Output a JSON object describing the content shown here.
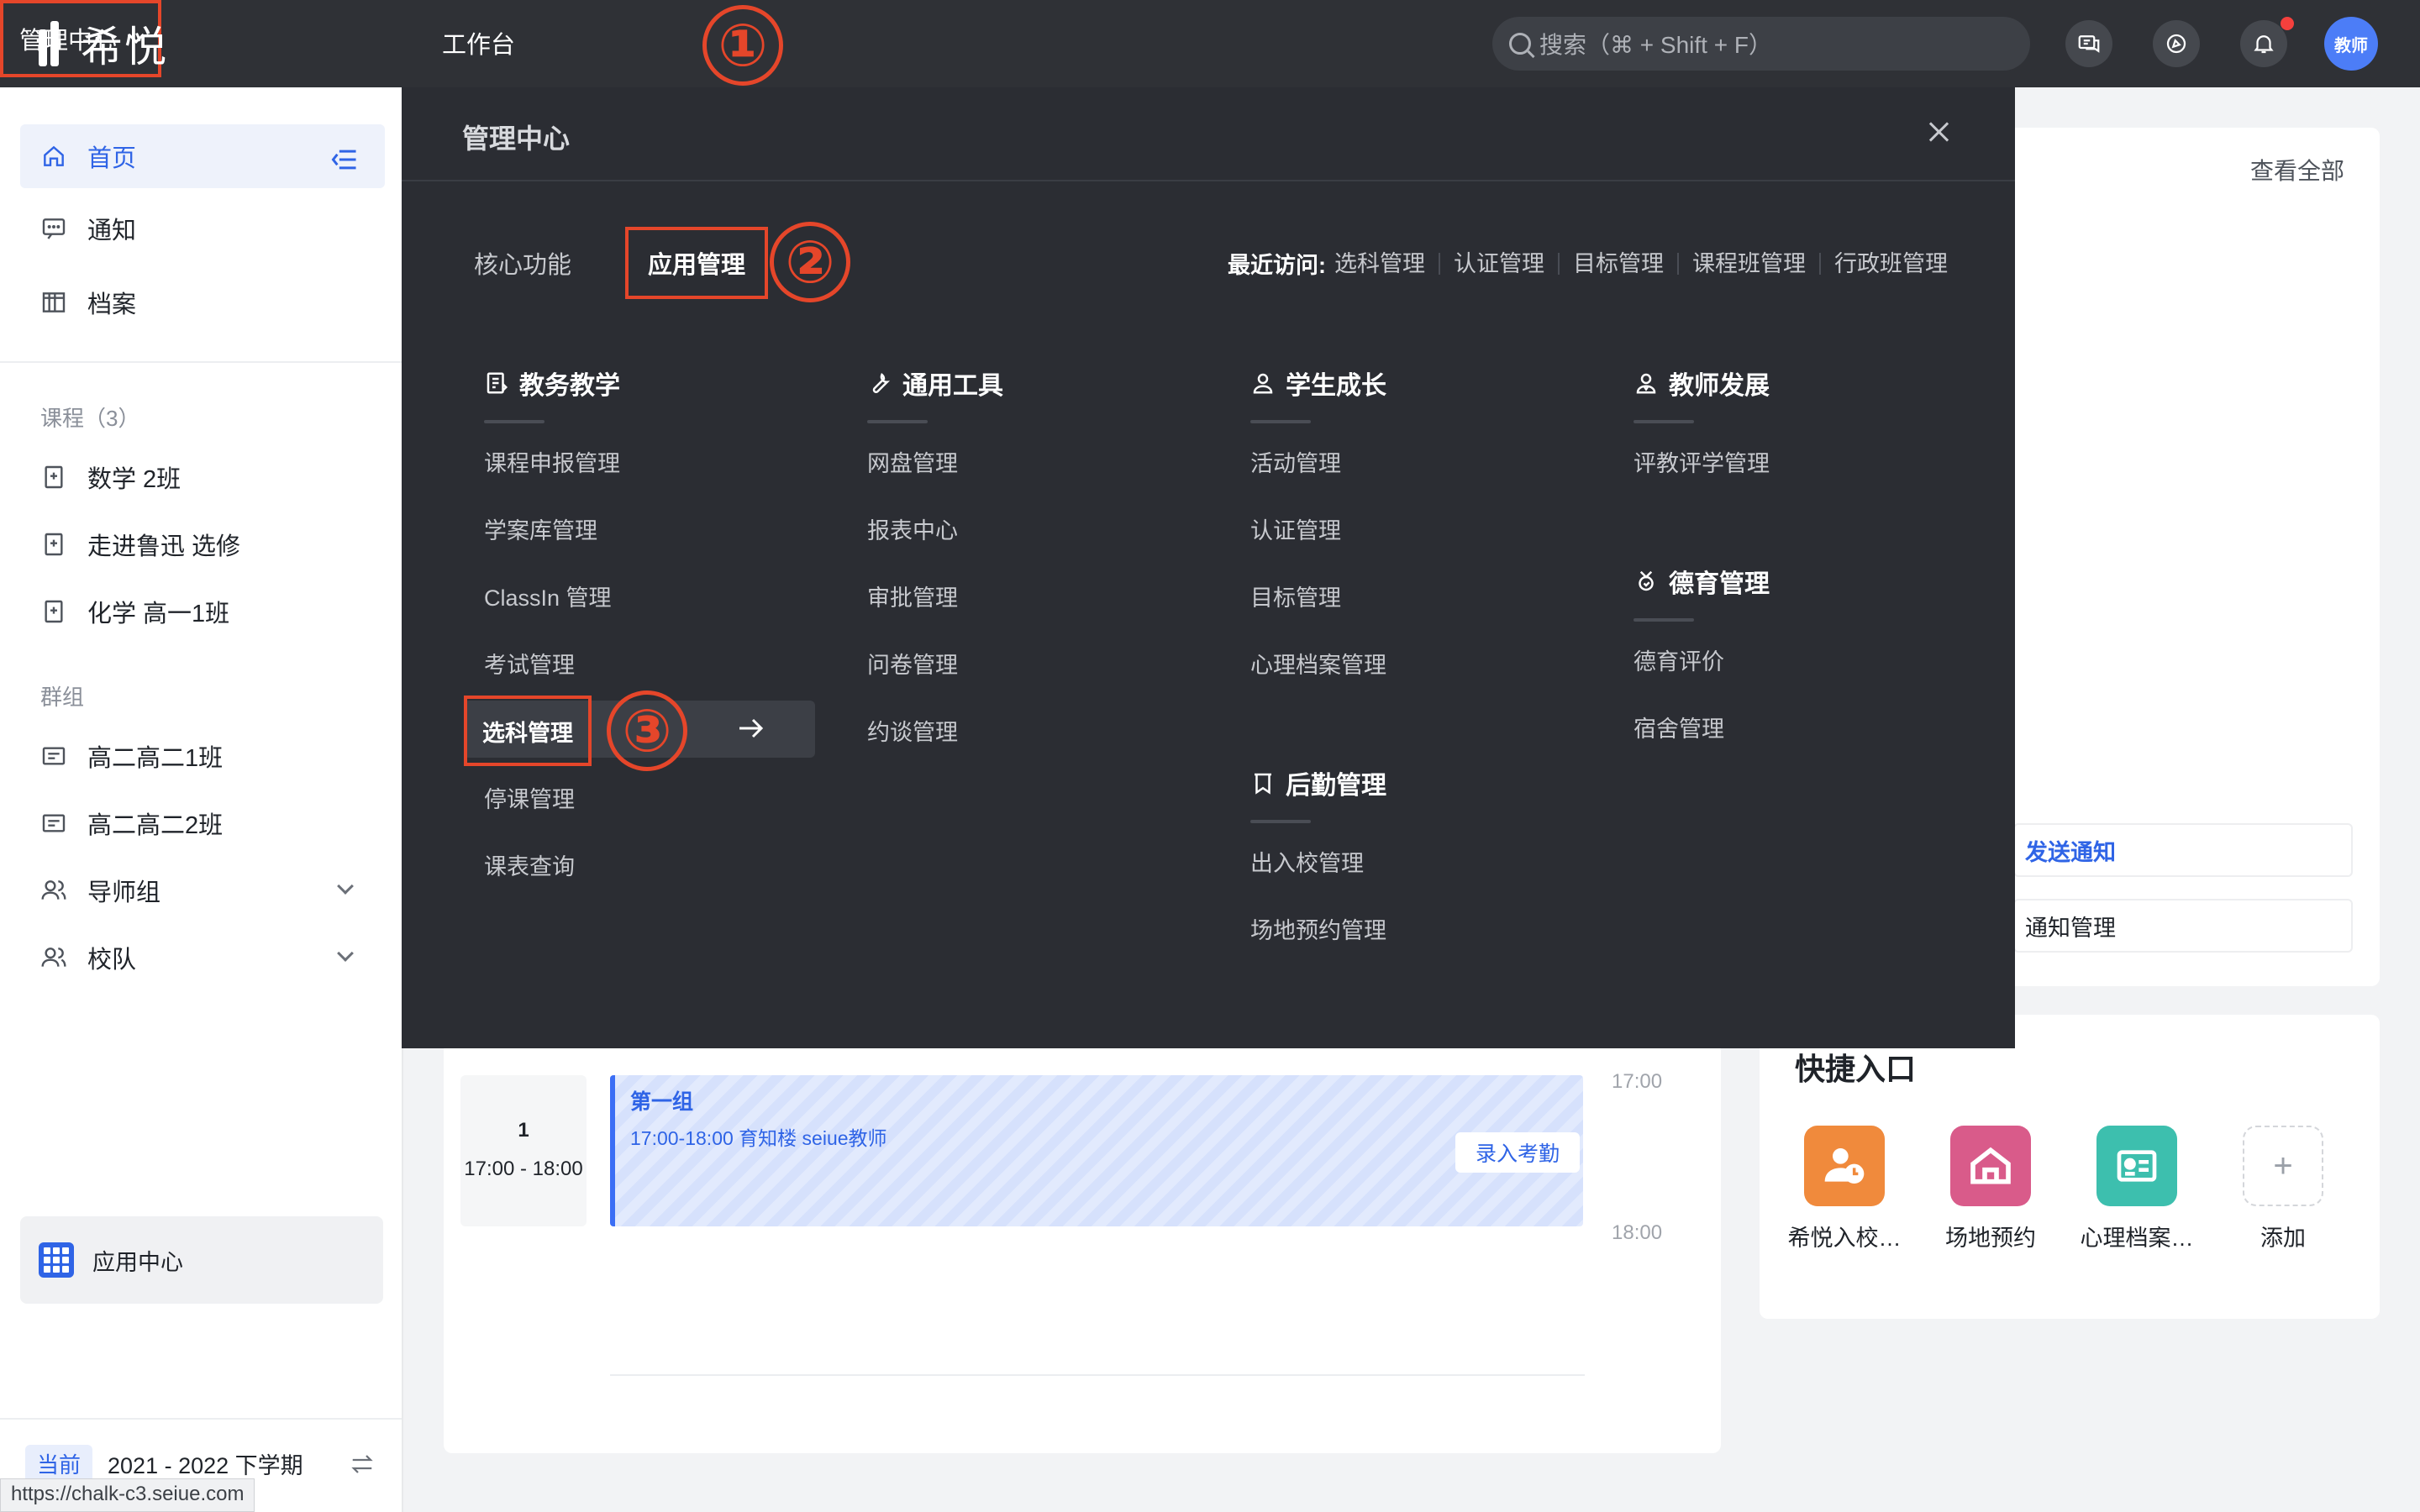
{
  "app": {
    "logo_text": "希悦"
  },
  "topnav": {
    "workbench": "工作台",
    "admin_center": "管理中心",
    "search_placeholder": "搜索（⌘ + Shift + F）",
    "avatar_text": "教师"
  },
  "annotations": {
    "step1": "①",
    "step2": "②",
    "step3": "③"
  },
  "sidebar": {
    "home": "首页",
    "notice": "通知",
    "archive": "档案",
    "courses_title": "课程（3）",
    "courses": [
      "数学 2班",
      "走进鲁迅 选修",
      "化学 高一1班"
    ],
    "groups_title": "群组",
    "groups": [
      "高二高二1班",
      "高二高二2班",
      "导师组",
      "校队"
    ],
    "app_center": "应用中心",
    "term_badge": "当前",
    "term_text": "2021 - 2022 下学期"
  },
  "status_url": "https://chalk-c3.seiue.com",
  "panel": {
    "title": "管理中心",
    "tab_core": "核心功能",
    "tab_apps": "应用管理",
    "recent_label": "最近访问:",
    "recent": [
      "选科管理",
      "认证管理",
      "目标管理",
      "课程班管理",
      "行政班管理"
    ],
    "categories": {
      "teaching": {
        "title": "教务教学",
        "items": [
          "课程申报管理",
          "学案库管理",
          "ClassIn 管理",
          "考试管理",
          "选科管理",
          "停课管理",
          "课表查询"
        ]
      },
      "tools": {
        "title": "通用工具",
        "items": [
          "网盘管理",
          "报表中心",
          "审批管理",
          "问卷管理",
          "约谈管理"
        ]
      },
      "student": {
        "title": "学生成长",
        "items": [
          "活动管理",
          "认证管理",
          "目标管理",
          "心理档案管理"
        ]
      },
      "logistics": {
        "title": "后勤管理",
        "items": [
          "出入校管理",
          "场地预约管理"
        ]
      },
      "teacher": {
        "title": "教师发展",
        "items": [
          "评教评学管理"
        ]
      },
      "moral": {
        "title": "德育管理",
        "items": [
          "德育评价",
          "宿舍管理"
        ]
      }
    }
  },
  "schedule": {
    "event_index": "1",
    "event_time": "17:00 - 18:00",
    "event_title": "第一组",
    "event_detail": "17:00-18:00  育知楼  seiue教师",
    "attendance_button": "录入考勤",
    "time_labels": [
      "17:00",
      "18:00"
    ]
  },
  "right_panel": {
    "view_all": "查看全部",
    "send_notice": "发送通知",
    "notice_manage": "通知管理",
    "shortcuts_title": "快捷入口",
    "shortcuts": [
      "希悦入校…",
      "场地预约",
      "心理档案…",
      "添加"
    ]
  },
  "colors": {
    "accent": "#2f64e6",
    "annotation_red": "#e5462a",
    "topbar": "#2f3136",
    "panel": "#2b2d33",
    "shortcut_orange": "#f08a3c",
    "shortcut_pink": "#d95b8a",
    "shortcut_teal": "#3dbfae"
  }
}
